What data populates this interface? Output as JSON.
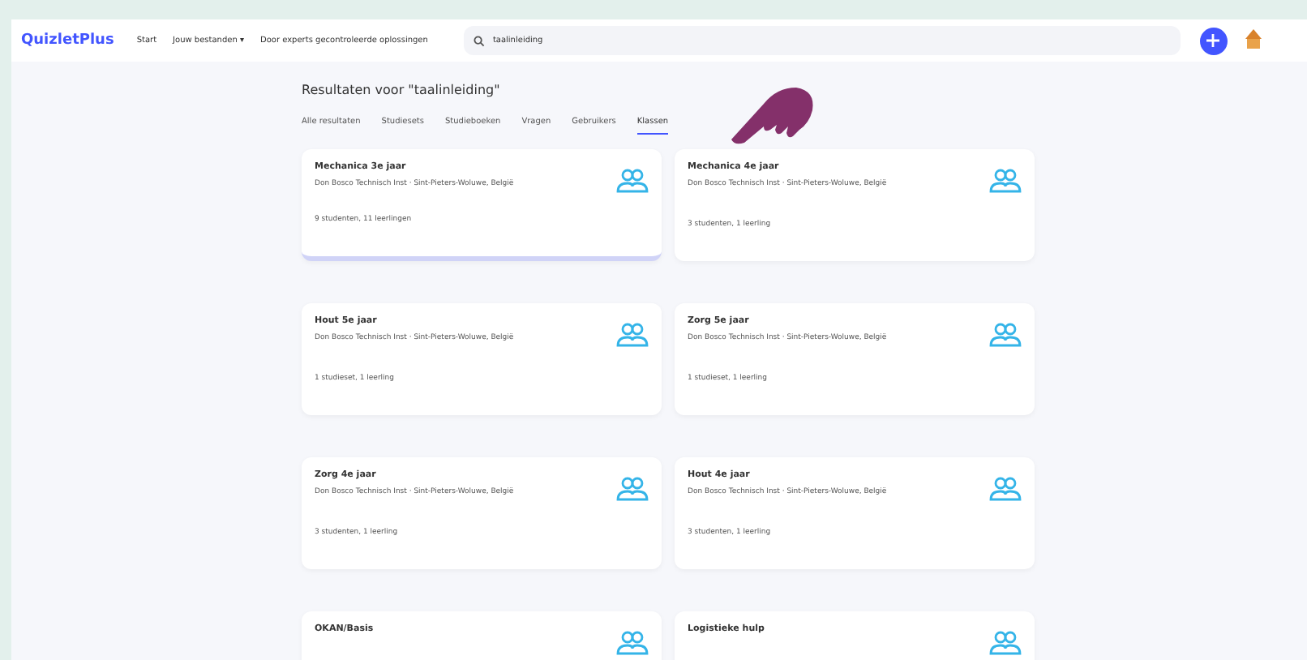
{
  "header": {
    "logo": "QuizletPlus",
    "nav": [
      {
        "label": "Start"
      },
      {
        "label": "Jouw bestanden",
        "caret": "▾"
      },
      {
        "label": "Door experts gecontroleerde oplossingen"
      }
    ],
    "search": {
      "value": "taalinleiding"
    }
  },
  "results": {
    "title": "Resultaten voor \"taalinleiding\"",
    "tabs": [
      {
        "label": "Alle resultaten",
        "selected": false
      },
      {
        "label": "Studiesets",
        "selected": false
      },
      {
        "label": "Studieboeken",
        "selected": false
      },
      {
        "label": "Vragen",
        "selected": false
      },
      {
        "label": "Gebruikers",
        "selected": false
      },
      {
        "label": "Klassen",
        "selected": true
      }
    ],
    "classes": [
      {
        "name": "Mechanica 3e jaar",
        "school": "Don Bosco Technisch Inst · Sint-Pieters-Woluwe, België",
        "counts": "9 studenten, 11 leerlingen",
        "highlighted": true
      },
      {
        "name": "Mechanica 4e jaar",
        "school": "Don Bosco Technisch Inst · Sint-Pieters-Woluwe, België",
        "counts": "3 studenten, 1 leerling",
        "highlighted": false
      },
      {
        "name": "Hout 5e jaar",
        "school": "Don Bosco Technisch Inst · Sint-Pieters-Woluwe, België",
        "counts": "1 studieset, 1 leerling",
        "highlighted": false
      },
      {
        "name": "Zorg 5e jaar",
        "school": "Don Bosco Technisch Inst · Sint-Pieters-Woluwe, België",
        "counts": "1 studieset, 1 leerling",
        "highlighted": false
      },
      {
        "name": "Zorg 4e jaar",
        "school": "Don Bosco Technisch Inst · Sint-Pieters-Woluwe, België",
        "counts": "3 studenten, 1 leerling",
        "highlighted": false
      },
      {
        "name": "Hout 4e jaar",
        "school": "Don Bosco Technisch Inst · Sint-Pieters-Woluwe, België",
        "counts": "3 studenten, 1 leerling",
        "highlighted": false
      },
      {
        "name": "OKAN/Basis"
      },
      {
        "name": "Logistieke hulp"
      }
    ]
  }
}
